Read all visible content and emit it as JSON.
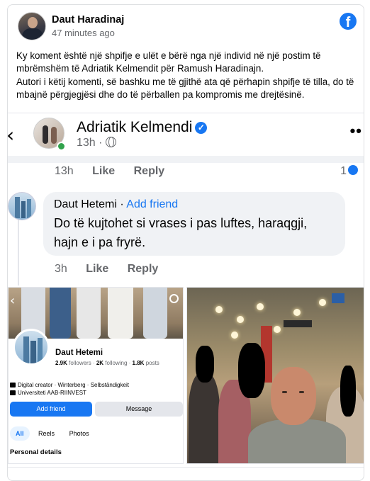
{
  "post": {
    "author": "Daut Haradinaj",
    "time": "47 minutes ago",
    "text": "Ky koment është një shpifje e ulët e bërë nga një individ në një postim të mbrëmshëm të Adriatik Kelmendit për Ramush Haradinajn.\nAutori i këtij komenti, së bashku me të gjithë ata që përhapin shpifje të tilla, do të mbajnë përgjegjësi dhe do të përballen pa kompromis me drejtësinë.",
    "logo": "f"
  },
  "embed": {
    "page_name": "Adriatik Kelmendi",
    "meta_time": "13h",
    "meta_sep": "·",
    "row1": {
      "time": "13h",
      "like": "Like",
      "reply": "Reply",
      "count": "1"
    },
    "comment": {
      "author": "Daut Hetemi",
      "sep": "·",
      "add_friend": "Add friend",
      "text": "Do të kujtohet si vrases i pas luftes, haraqgji, hajn e i pa fryrë."
    },
    "row2": {
      "time": "3h",
      "like": "Like",
      "reply": "Reply"
    }
  },
  "profile_shot": {
    "name": "Daut Hetemi",
    "followers": "2.9K",
    "followers_label": "followers",
    "following": "2K",
    "following_label": "following",
    "posts": "1.8K",
    "posts_label": "posts",
    "info_line1": "Digital creator · Winterberg · Selbständigkeit",
    "info_line2": "Universiteti AAB-RIINVEST",
    "add_friend": "Add friend",
    "message": "Message",
    "tabs": [
      "All",
      "Reels",
      "Photos"
    ],
    "details_heading": "Personal details"
  },
  "colors": {
    "accent": "#1877f2",
    "text": "#050505",
    "muted": "#65676b",
    "bubble": "#f0f2f5",
    "online": "#31a24c"
  }
}
